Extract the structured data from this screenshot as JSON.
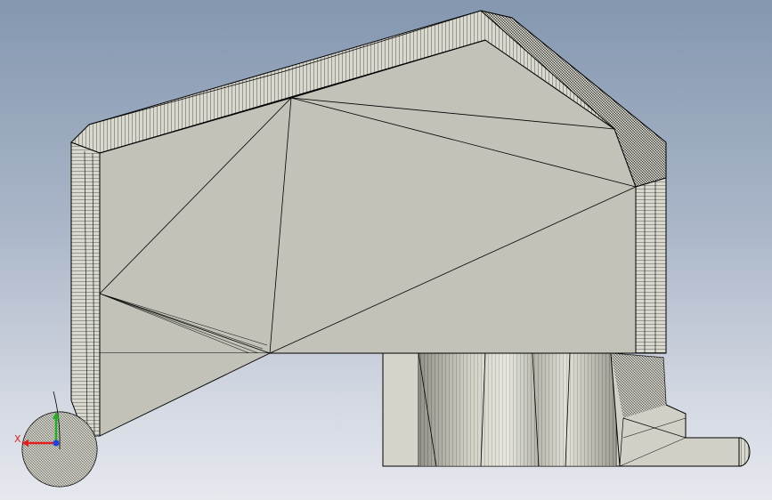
{
  "viewport": {
    "background_top": "#8497b0",
    "background_bottom": "#e6e8ee"
  },
  "model": {
    "face_color": "#c2c2b8",
    "edge_color": "#000000",
    "render_mode": "shaded-with-mesh-edges"
  },
  "triad": {
    "x_label": "X",
    "x_color": "#e02020",
    "y_color": "#20b020",
    "z_color": "#2040e0"
  }
}
